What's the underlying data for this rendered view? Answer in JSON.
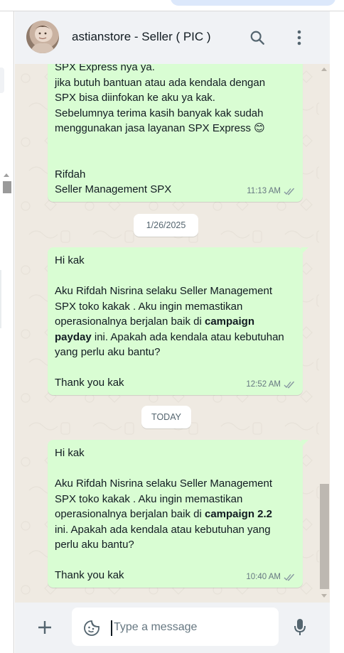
{
  "header": {
    "contact_name": "astianstore - Seller ( PIC )",
    "search_icon": "search-icon",
    "menu_icon": "more-vertical-icon"
  },
  "messages": [
    {
      "lines": [
        "SPX Express nya ya.",
        "jika butuh bantuan atau ada kendala dengan",
        "SPX bisa diinfokan ke aku ya kak.",
        "Sebelumnya terima kasih banyak kak sudah",
        "menggunakan jasa layanan SPX Express 😊",
        "",
        "",
        "Rifdah",
        "Seller Management SPX"
      ],
      "time": "11:13 AM",
      "status_icon": "double-check-icon"
    },
    {
      "lines": [
        "Hi kak",
        "",
        "Aku Rifdah Nisrina selaku Seller Management",
        "SPX toko kakak . Aku ingin memastikan",
        "operasionalnya berjalan baik di",
        "payday",
        "yang perlu aku bantu?",
        "",
        "Thank you kak"
      ],
      "bold_1": "campaign",
      "tail_1": " ini. Apakah ada kendala atau kebutuhan",
      "time": "12:52 AM",
      "status_icon": "double-check-icon"
    },
    {
      "lines": [
        "Hi kak",
        "",
        "Aku Rifdah Nisrina selaku Seller Management",
        "SPX toko kakak . Aku ingin memastikan",
        "operasionalnya berjalan baik di",
        "ini. Apakah ada kendala atau kebutuhan yang",
        "perlu aku bantu?",
        "",
        "Thank you kak"
      ],
      "bold_1": "campaign 2.2",
      "time": "10:40 AM",
      "status_icon": "double-check-icon"
    }
  ],
  "date_separators": [
    "1/26/2025",
    "TODAY"
  ],
  "composer": {
    "placeholder": "Type a message",
    "attach_icon": "plus-icon",
    "sticker_icon": "sticker-icon",
    "mic_icon": "microphone-icon"
  },
  "colors": {
    "outgoing_bubble": "#d9fdd3",
    "chat_background": "#efeae2",
    "panel": "#f0f2f5",
    "meta_text": "#667781"
  }
}
